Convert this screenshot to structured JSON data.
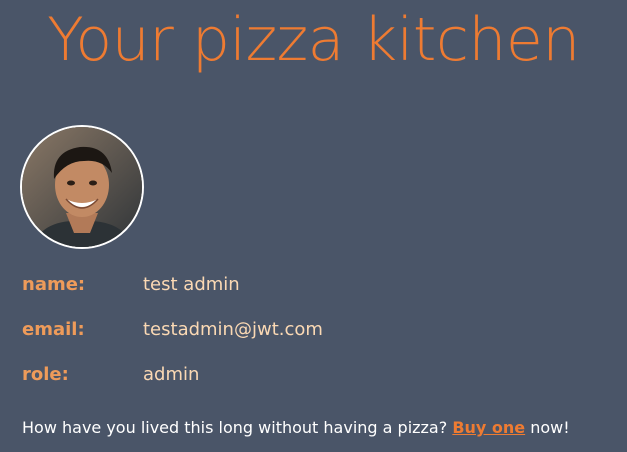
{
  "header": {
    "title": "Your pizza kitchen"
  },
  "profile": {
    "avatar_icon": "user-avatar-photo",
    "fields": [
      {
        "label": "name:",
        "value": "test admin"
      },
      {
        "label": "email:",
        "value": "testadmin@jwt.com"
      },
      {
        "label": "role:",
        "value": "admin"
      }
    ]
  },
  "promo": {
    "text_before": "How have you lived this long without having a pizza?",
    "link_label": "Buy one",
    "text_after": "now!"
  },
  "colors": {
    "background": "#4a5568",
    "accent": "#ee7b32",
    "label": "#ee9b5a",
    "value": "#fbd9b4"
  }
}
